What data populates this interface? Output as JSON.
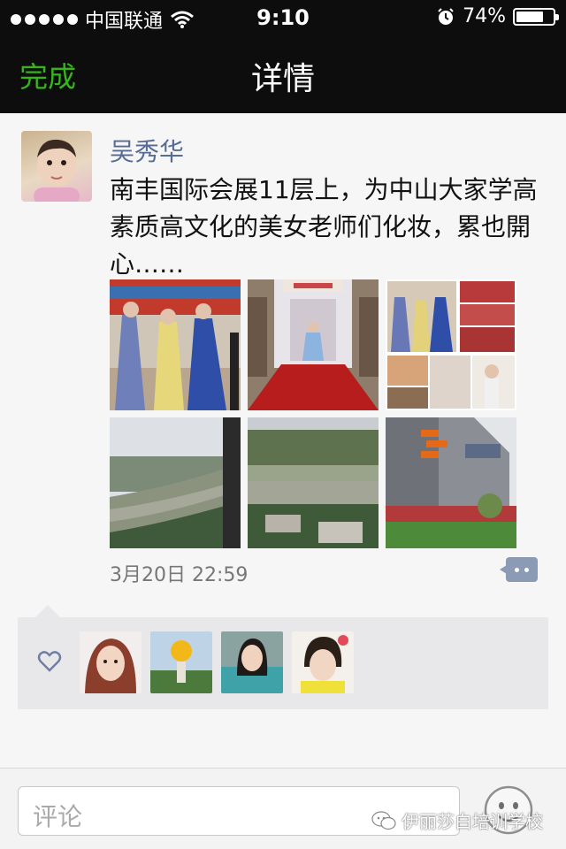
{
  "status_bar": {
    "carrier": "中国联通",
    "time": "9:10",
    "battery": "74%",
    "battery_level": 0.74,
    "icons": [
      "signal-dots-icon",
      "wifi-icon",
      "alarm-clock-icon",
      "battery-icon"
    ]
  },
  "nav": {
    "done_label": "完成",
    "title": "详情"
  },
  "post": {
    "author": "吴秀华",
    "text": "南丰国际会展11层上，为中山大家学高素质高文化的美女老师们化妆，累也開心……",
    "timestamp": "3月20日 22:59",
    "photos": [
      "photo-group-blue-gowns",
      "photo-red-carpet",
      "photo-collage",
      "photo-river-view",
      "photo-river-city",
      "photo-modern-building"
    ]
  },
  "likes": {
    "icon": "heart-outline-icon",
    "avatars": [
      "avatar-liker-1",
      "avatar-liker-2",
      "avatar-liker-3",
      "avatar-liker-4"
    ]
  },
  "comment_bar": {
    "placeholder": "评论",
    "emoji_icon": "smiley-face-icon"
  },
  "watermark": {
    "text": "伊丽莎白培训学校",
    "icon": "wechat-logo-icon"
  },
  "colors": {
    "nav_background": "#0d0d0d",
    "accent_green": "#35b51c",
    "name_blue": "#586b95"
  }
}
